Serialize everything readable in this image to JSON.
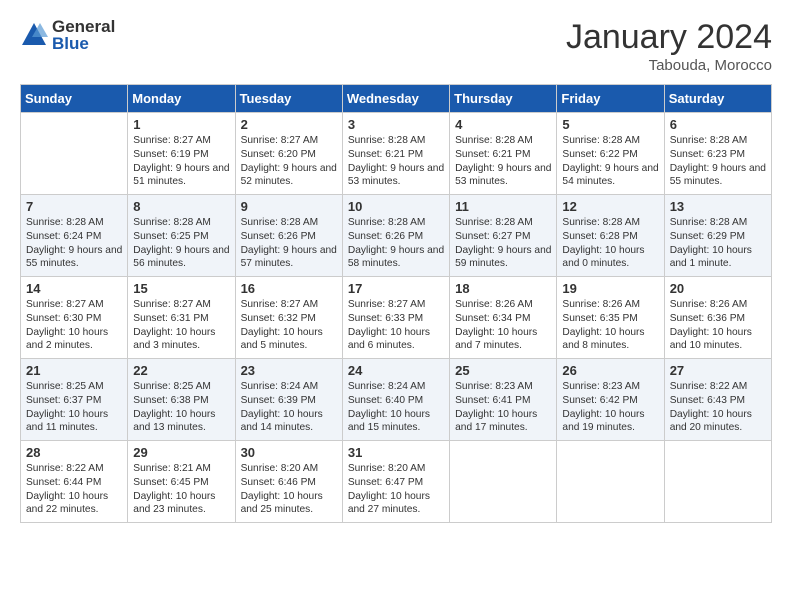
{
  "logo": {
    "general": "General",
    "blue": "Blue"
  },
  "title": "January 2024",
  "subtitle": "Tabouda, Morocco",
  "headers": [
    "Sunday",
    "Monday",
    "Tuesday",
    "Wednesday",
    "Thursday",
    "Friday",
    "Saturday"
  ],
  "weeks": [
    [
      {
        "num": "",
        "sunrise": "",
        "sunset": "",
        "daylight": ""
      },
      {
        "num": "1",
        "sunrise": "Sunrise: 8:27 AM",
        "sunset": "Sunset: 6:19 PM",
        "daylight": "Daylight: 9 hours and 51 minutes."
      },
      {
        "num": "2",
        "sunrise": "Sunrise: 8:27 AM",
        "sunset": "Sunset: 6:20 PM",
        "daylight": "Daylight: 9 hours and 52 minutes."
      },
      {
        "num": "3",
        "sunrise": "Sunrise: 8:28 AM",
        "sunset": "Sunset: 6:21 PM",
        "daylight": "Daylight: 9 hours and 53 minutes."
      },
      {
        "num": "4",
        "sunrise": "Sunrise: 8:28 AM",
        "sunset": "Sunset: 6:21 PM",
        "daylight": "Daylight: 9 hours and 53 minutes."
      },
      {
        "num": "5",
        "sunrise": "Sunrise: 8:28 AM",
        "sunset": "Sunset: 6:22 PM",
        "daylight": "Daylight: 9 hours and 54 minutes."
      },
      {
        "num": "6",
        "sunrise": "Sunrise: 8:28 AM",
        "sunset": "Sunset: 6:23 PM",
        "daylight": "Daylight: 9 hours and 55 minutes."
      }
    ],
    [
      {
        "num": "7",
        "sunrise": "Sunrise: 8:28 AM",
        "sunset": "Sunset: 6:24 PM",
        "daylight": "Daylight: 9 hours and 55 minutes."
      },
      {
        "num": "8",
        "sunrise": "Sunrise: 8:28 AM",
        "sunset": "Sunset: 6:25 PM",
        "daylight": "Daylight: 9 hours and 56 minutes."
      },
      {
        "num": "9",
        "sunrise": "Sunrise: 8:28 AM",
        "sunset": "Sunset: 6:26 PM",
        "daylight": "Daylight: 9 hours and 57 minutes."
      },
      {
        "num": "10",
        "sunrise": "Sunrise: 8:28 AM",
        "sunset": "Sunset: 6:26 PM",
        "daylight": "Daylight: 9 hours and 58 minutes."
      },
      {
        "num": "11",
        "sunrise": "Sunrise: 8:28 AM",
        "sunset": "Sunset: 6:27 PM",
        "daylight": "Daylight: 9 hours and 59 minutes."
      },
      {
        "num": "12",
        "sunrise": "Sunrise: 8:28 AM",
        "sunset": "Sunset: 6:28 PM",
        "daylight": "Daylight: 10 hours and 0 minutes."
      },
      {
        "num": "13",
        "sunrise": "Sunrise: 8:28 AM",
        "sunset": "Sunset: 6:29 PM",
        "daylight": "Daylight: 10 hours and 1 minute."
      }
    ],
    [
      {
        "num": "14",
        "sunrise": "Sunrise: 8:27 AM",
        "sunset": "Sunset: 6:30 PM",
        "daylight": "Daylight: 10 hours and 2 minutes."
      },
      {
        "num": "15",
        "sunrise": "Sunrise: 8:27 AM",
        "sunset": "Sunset: 6:31 PM",
        "daylight": "Daylight: 10 hours and 3 minutes."
      },
      {
        "num": "16",
        "sunrise": "Sunrise: 8:27 AM",
        "sunset": "Sunset: 6:32 PM",
        "daylight": "Daylight: 10 hours and 5 minutes."
      },
      {
        "num": "17",
        "sunrise": "Sunrise: 8:27 AM",
        "sunset": "Sunset: 6:33 PM",
        "daylight": "Daylight: 10 hours and 6 minutes."
      },
      {
        "num": "18",
        "sunrise": "Sunrise: 8:26 AM",
        "sunset": "Sunset: 6:34 PM",
        "daylight": "Daylight: 10 hours and 7 minutes."
      },
      {
        "num": "19",
        "sunrise": "Sunrise: 8:26 AM",
        "sunset": "Sunset: 6:35 PM",
        "daylight": "Daylight: 10 hours and 8 minutes."
      },
      {
        "num": "20",
        "sunrise": "Sunrise: 8:26 AM",
        "sunset": "Sunset: 6:36 PM",
        "daylight": "Daylight: 10 hours and 10 minutes."
      }
    ],
    [
      {
        "num": "21",
        "sunrise": "Sunrise: 8:25 AM",
        "sunset": "Sunset: 6:37 PM",
        "daylight": "Daylight: 10 hours and 11 minutes."
      },
      {
        "num": "22",
        "sunrise": "Sunrise: 8:25 AM",
        "sunset": "Sunset: 6:38 PM",
        "daylight": "Daylight: 10 hours and 13 minutes."
      },
      {
        "num": "23",
        "sunrise": "Sunrise: 8:24 AM",
        "sunset": "Sunset: 6:39 PM",
        "daylight": "Daylight: 10 hours and 14 minutes."
      },
      {
        "num": "24",
        "sunrise": "Sunrise: 8:24 AM",
        "sunset": "Sunset: 6:40 PM",
        "daylight": "Daylight: 10 hours and 15 minutes."
      },
      {
        "num": "25",
        "sunrise": "Sunrise: 8:23 AM",
        "sunset": "Sunset: 6:41 PM",
        "daylight": "Daylight: 10 hours and 17 minutes."
      },
      {
        "num": "26",
        "sunrise": "Sunrise: 8:23 AM",
        "sunset": "Sunset: 6:42 PM",
        "daylight": "Daylight: 10 hours and 19 minutes."
      },
      {
        "num": "27",
        "sunrise": "Sunrise: 8:22 AM",
        "sunset": "Sunset: 6:43 PM",
        "daylight": "Daylight: 10 hours and 20 minutes."
      }
    ],
    [
      {
        "num": "28",
        "sunrise": "Sunrise: 8:22 AM",
        "sunset": "Sunset: 6:44 PM",
        "daylight": "Daylight: 10 hours and 22 minutes."
      },
      {
        "num": "29",
        "sunrise": "Sunrise: 8:21 AM",
        "sunset": "Sunset: 6:45 PM",
        "daylight": "Daylight: 10 hours and 23 minutes."
      },
      {
        "num": "30",
        "sunrise": "Sunrise: 8:20 AM",
        "sunset": "Sunset: 6:46 PM",
        "daylight": "Daylight: 10 hours and 25 minutes."
      },
      {
        "num": "31",
        "sunrise": "Sunrise: 8:20 AM",
        "sunset": "Sunset: 6:47 PM",
        "daylight": "Daylight: 10 hours and 27 minutes."
      },
      {
        "num": "",
        "sunrise": "",
        "sunset": "",
        "daylight": ""
      },
      {
        "num": "",
        "sunrise": "",
        "sunset": "",
        "daylight": ""
      },
      {
        "num": "",
        "sunrise": "",
        "sunset": "",
        "daylight": ""
      }
    ]
  ]
}
